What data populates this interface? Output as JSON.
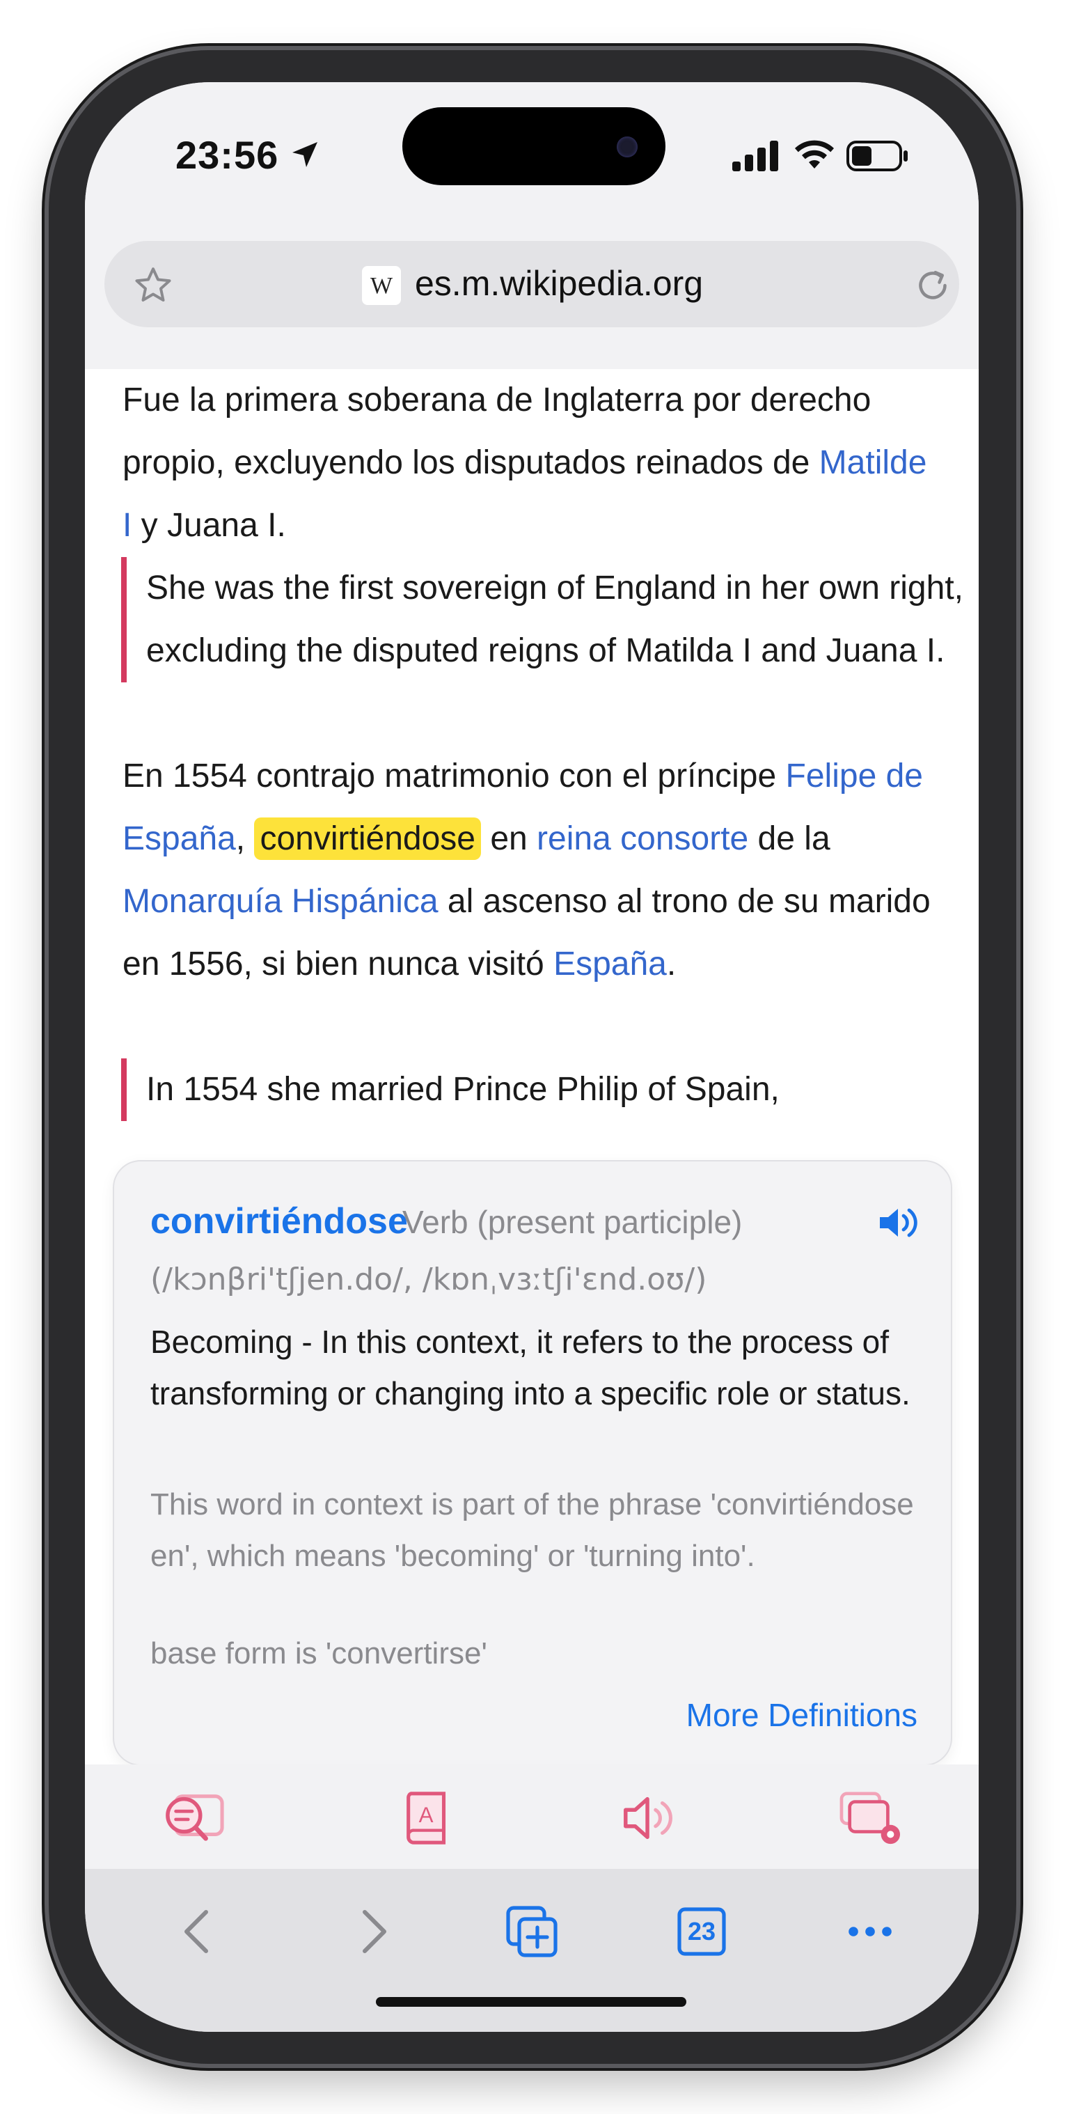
{
  "status_bar": {
    "time": "23:56"
  },
  "address_bar": {
    "domain": "es.m.wikipedia.org",
    "site_logo": "W"
  },
  "article": {
    "p1": {
      "text_a": "Fue la primera soberana de Inglaterra por derecho propio, excluyendo los disputados reinados de ",
      "link1": "Matilde I",
      "text_b": " y Juana I."
    },
    "q1": "She was the first sovereign of England in her own right, excluding the disputed reigns of Matilda I and Juana I.",
    "p2": {
      "text_a": "En 1554 contrajo matrimonio con el príncipe ",
      "link1": "Felipe de España",
      "text_b": ", ",
      "highlight": "convirtiéndose",
      "text_c": " en ",
      "link2": "reina consorte",
      "text_d": " de la ",
      "link3": "Monarquía Hispánica",
      "text_e": " al ascenso al trono de su marido en 1556, si bien nunca visitó ",
      "link4": "España",
      "text_f": "."
    },
    "q2": "In 1554 she married Prince Philip of Spain,"
  },
  "definition": {
    "word": "convirtiéndose",
    "part_of_speech": "Verb (present participle)",
    "ipa": "(/kɔnβri'tʃjen.do/, /kɒnˌvɜːtʃi'ɛnd.oʊ/)",
    "meaning": "Becoming - In this context, it refers to the process of transforming or changing into a specific role or status.",
    "context": "This word in context is part of the phrase 'convirtiéndose en', which means 'becoming' or 'turning into'.",
    "base_form": "base form is 'convertirse'",
    "more_link": "More Definitions"
  },
  "toolbar": {
    "icons": [
      "search-text-icon",
      "dictionary-book-icon",
      "speaker-icon",
      "windows-settings-icon"
    ],
    "accent_color": "#e0587c"
  },
  "browser_nav": {
    "tab_count": "23",
    "icons": [
      "back-chevron-icon",
      "forward-chevron-icon",
      "new-tab-icon",
      "tabs-icon",
      "more-icon"
    ],
    "accent_color": "#1a73e8"
  }
}
